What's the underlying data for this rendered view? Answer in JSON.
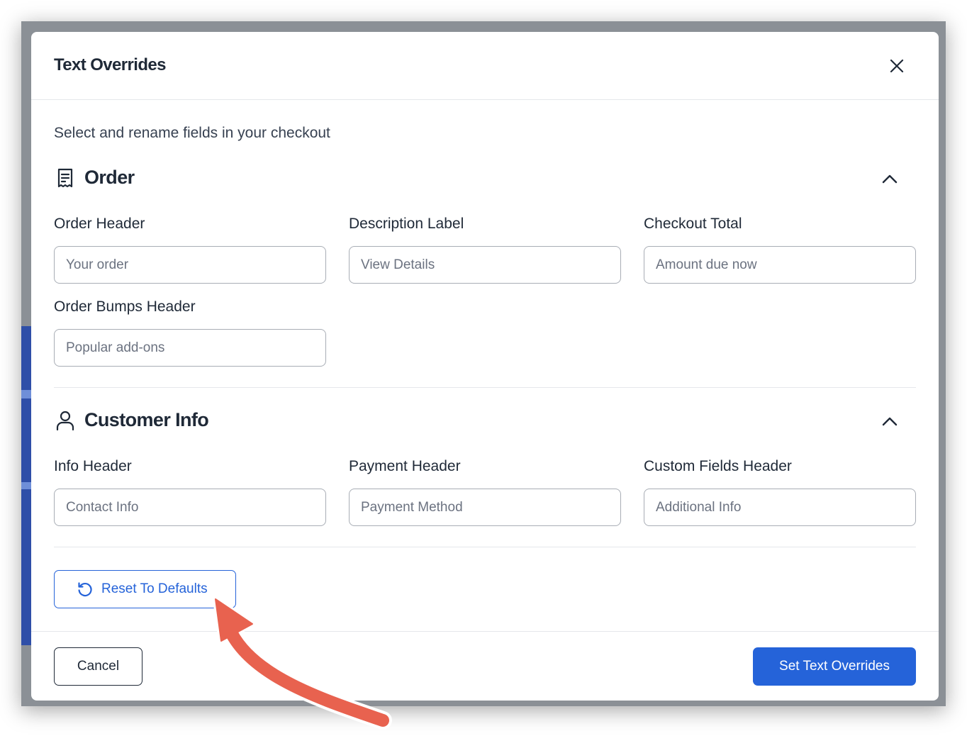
{
  "modal": {
    "title": "Text Overrides",
    "intro": "Select and rename fields in your checkout"
  },
  "sections": [
    {
      "title": "Order",
      "icon": "receipt-icon",
      "fields": [
        {
          "label": "Order Header",
          "placeholder": "Your order"
        },
        {
          "label": "Description Label",
          "placeholder": "View Details"
        },
        {
          "label": "Checkout Total",
          "placeholder": "Amount due now"
        },
        {
          "label": "Order Bumps Header",
          "placeholder": "Popular add-ons"
        }
      ]
    },
    {
      "title": "Customer Info",
      "icon": "user-icon",
      "fields": [
        {
          "label": "Info Header",
          "placeholder": "Contact Info"
        },
        {
          "label": "Payment Header",
          "placeholder": "Payment Method"
        },
        {
          "label": "Custom Fields Header",
          "placeholder": "Additional Info"
        }
      ]
    }
  ],
  "actions": {
    "reset_label": "Reset To Defaults",
    "cancel_label": "Cancel",
    "submit_label": "Set Text Overrides"
  },
  "colors": {
    "primary": "#2563d9",
    "annotation_arrow": "#e8624f",
    "backdrop": "#8b9096"
  }
}
